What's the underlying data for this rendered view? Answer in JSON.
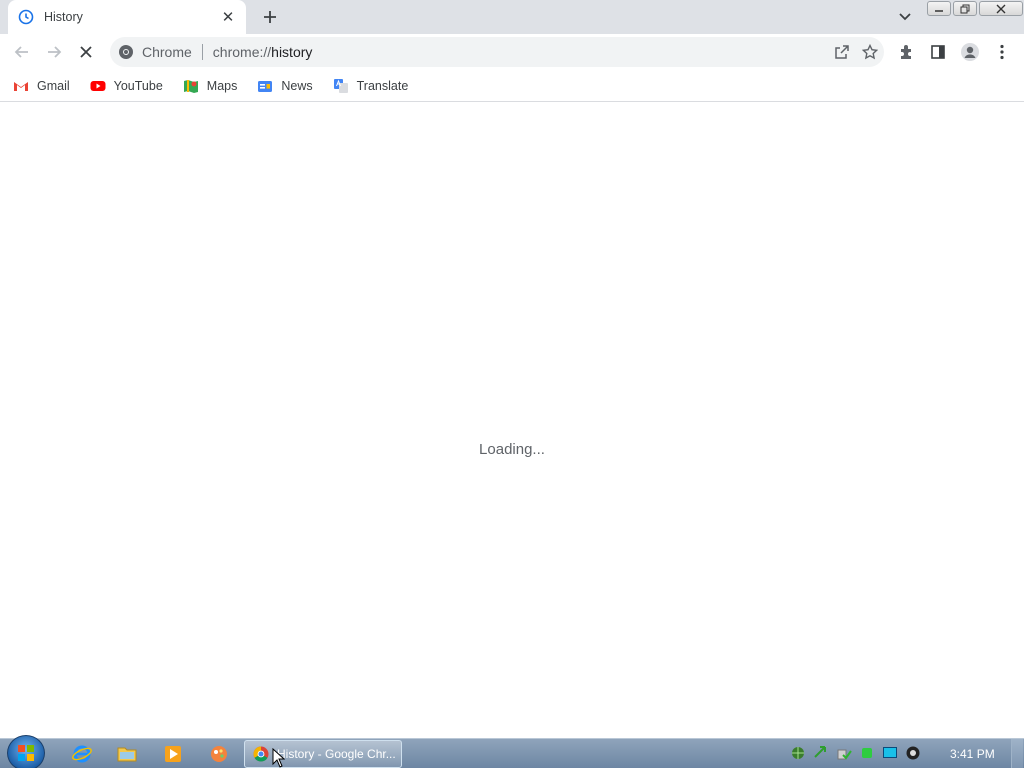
{
  "tab": {
    "title": "History",
    "close_glyph": "✕"
  },
  "toolbar": {
    "site_chip": "Chrome",
    "url_scheme": "chrome://",
    "url_path": "history"
  },
  "bookmarks": [
    {
      "label": "Gmail",
      "icon": "gmail-icon"
    },
    {
      "label": "YouTube",
      "icon": "youtube-icon"
    },
    {
      "label": "Maps",
      "icon": "maps-icon"
    },
    {
      "label": "News",
      "icon": "news-icon"
    },
    {
      "label": "Translate",
      "icon": "translate-icon"
    }
  ],
  "page": {
    "loading_text": "Loading..."
  },
  "taskbar": {
    "active_task_label": "History - Google Chr...",
    "clock": "3:41 PM"
  },
  "colors": {
    "tabstrip": "#dee1e6",
    "omnibox": "#f1f3f4",
    "taskbar": "#6d86a3"
  }
}
